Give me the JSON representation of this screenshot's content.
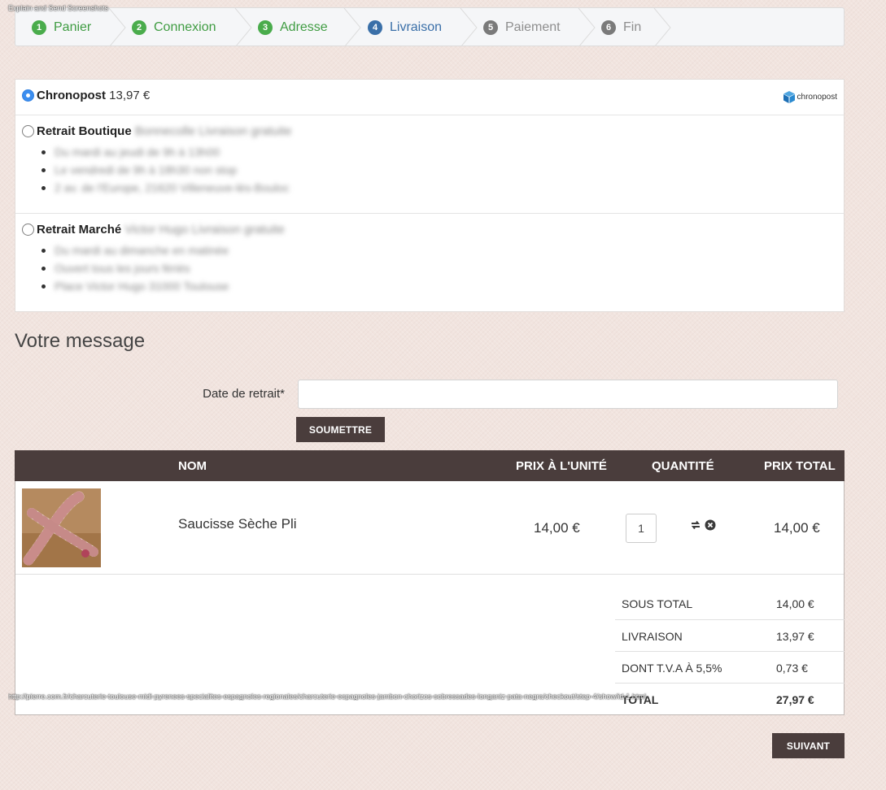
{
  "overlay": {
    "title": "Explain and Send Screenshots",
    "url": "http://pierre.com.fr/charcuterie-toulouse-midi-pyrenees-specialites-espagnoles-regionales/charcuterie-espagnoles-jambon-chorizos-sobressades-longaniz-pata-negra/checkout/step-4/show/id-1.html"
  },
  "steps": [
    {
      "num": "1",
      "label": "Panier",
      "state": "done"
    },
    {
      "num": "2",
      "label": "Connexion",
      "state": "done"
    },
    {
      "num": "3",
      "label": "Adresse",
      "state": "done"
    },
    {
      "num": "4",
      "label": "Livraison",
      "state": "current"
    },
    {
      "num": "5",
      "label": "Paiement",
      "state": "todo"
    },
    {
      "num": "6",
      "label": "Fin",
      "state": "todo"
    }
  ],
  "shipping": {
    "chronopost": {
      "name": "Chronopost",
      "price": "13,97 €",
      "logo_text": "chronopost",
      "selected": true
    },
    "boutique": {
      "name": "Retrait Boutique",
      "blurred": "Bonnecolle Livraison gratuite",
      "lines": [
        "Du mardi au jeudi de 9h à 13h00",
        "Le vendredi de 9h à 18h30 non stop",
        "2 av. de l'Europe, 21620 Villeneuve-lès-Bouloc"
      ]
    },
    "marche": {
      "name": "Retrait Marché",
      "blurred": "Victor Hugo Livraison gratuite",
      "lines": [
        "Du mardi au dimanche en matinée",
        "Ouvert tous les jours fériés",
        "Place Victor Hugo 31000 Toulouse"
      ]
    }
  },
  "message": {
    "title": "Votre message",
    "date_label": "Date de retrait*",
    "date_value": "",
    "date_placeholder": "",
    "submit_label": "SOUMETTRE"
  },
  "cart": {
    "headers": {
      "name": "NOM",
      "unit_price": "PRIX À L'UNITÉ",
      "quantity": "QUANTITÉ",
      "total": "PRIX TOTAL"
    },
    "items": [
      {
        "name": "Saucisse Sèche Pli",
        "unit_price": "14,00 €",
        "quantity": "1",
        "total": "14,00 €"
      }
    ],
    "totals": [
      {
        "label": "SOUS TOTAL",
        "value": "14,00 €"
      },
      {
        "label": "LIVRAISON",
        "value": "13,97 €"
      },
      {
        "label": "DONT T.V.A À 5,5%",
        "value": "0,73 €"
      },
      {
        "label": "TOTAL",
        "value": "27,97 €"
      }
    ]
  },
  "next_label": "SUIVANT",
  "colors": {
    "accent_green": "#4aac4c",
    "accent_blue": "#3a6fa8",
    "dark_button": "#4a3d3c",
    "radio_selected": "#3b8ef0"
  },
  "icons": [
    "refresh-icon",
    "remove-circle-icon",
    "chronopost-logo-icon"
  ]
}
